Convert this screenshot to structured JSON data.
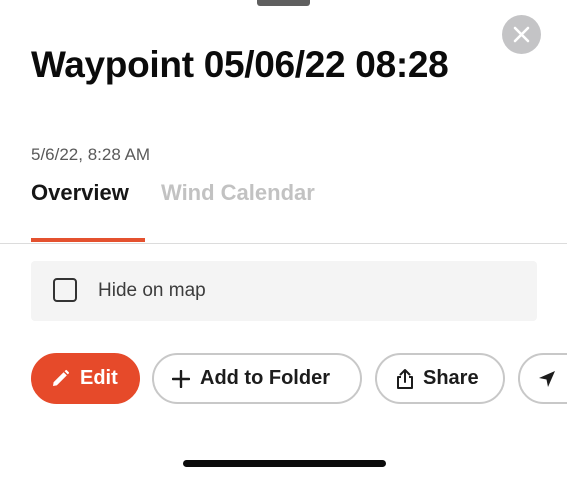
{
  "waypoint": {
    "title": "Waypoint 05/06/22 08:28",
    "date": "5/6/22, 8:28 AM"
  },
  "tabs": [
    {
      "label": "Overview",
      "active": true
    },
    {
      "label": "Wind Calendar",
      "active": false
    }
  ],
  "hide_on_map": {
    "label": "Hide on map",
    "checked": false
  },
  "actions": {
    "edit": {
      "label": "Edit",
      "icon": "pencil-icon"
    },
    "add_to_folder": {
      "label": "Add to Folder",
      "icon": "plus-icon"
    },
    "share": {
      "label": "Share",
      "icon": "share-icon"
    },
    "navigate": {
      "label": "",
      "icon": "navigation-arrow-icon"
    }
  },
  "close": {
    "icon": "close-icon"
  },
  "colors": {
    "accent": "#e64a2a",
    "tab_inactive": "#c2c2c2",
    "close_bg": "#c4c4c6",
    "row_bg": "#f4f4f4"
  }
}
